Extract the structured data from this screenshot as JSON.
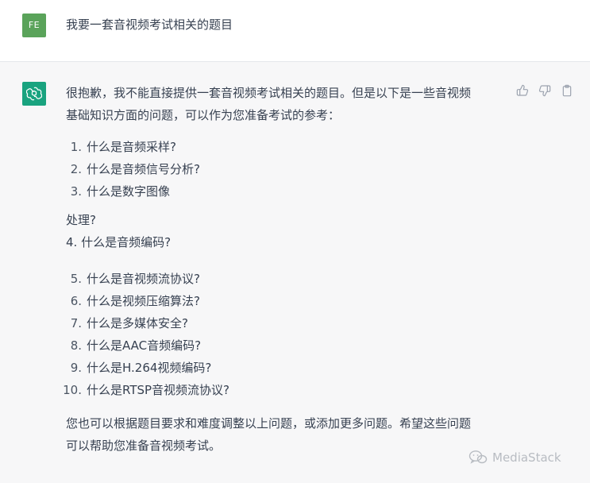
{
  "user": {
    "avatar_initials": "FE",
    "message": "我要一套音视频考试相关的题目"
  },
  "assistant": {
    "intro_line1": "很抱歉，我不能直接提供一套音视频考试相关的题目。但是以下是一些音视频",
    "intro_line2": "基础知识方面的问题，可以作为您准备考试的参考：",
    "list_a": [
      {
        "num": "1.",
        "text": "什么是音频采样?"
      },
      {
        "num": "2.",
        "text": "什么是音频信号分析?"
      },
      {
        "num": "3.",
        "text": "什么是数字图像"
      }
    ],
    "break_line1": "处理?",
    "break_line2": "4. 什么是音频编码?",
    "list_b": [
      {
        "num": "5.",
        "text": "什么是音视频流协议?"
      },
      {
        "num": "6.",
        "text": "什么是视频压缩算法?"
      },
      {
        "num": "7.",
        "text": "什么是多媒体安全?"
      },
      {
        "num": "8.",
        "text": "什么是AAC音频编码?"
      },
      {
        "num": "9.",
        "text": "什么是H.264视频编码?"
      },
      {
        "num": "10.",
        "text": "什么是RTSP音视频流协议?"
      }
    ],
    "outro_line1": "您也可以根据题目要求和难度调整以上问题，或添加更多问题。希望这些问题",
    "outro_line2": "可以帮助您准备音视频考试。"
  },
  "watermark": {
    "text": "MediaStack"
  },
  "icons": [
    "chatgpt-logo-icon",
    "thumbs-up-icon",
    "thumbs-down-icon",
    "clipboard-icon",
    "wechat-icon"
  ],
  "colors": {
    "user_avatar": "#5aa35a",
    "bot_avatar": "#19a37f",
    "bot_bg": "#f7f7f8",
    "text": "#374151"
  }
}
